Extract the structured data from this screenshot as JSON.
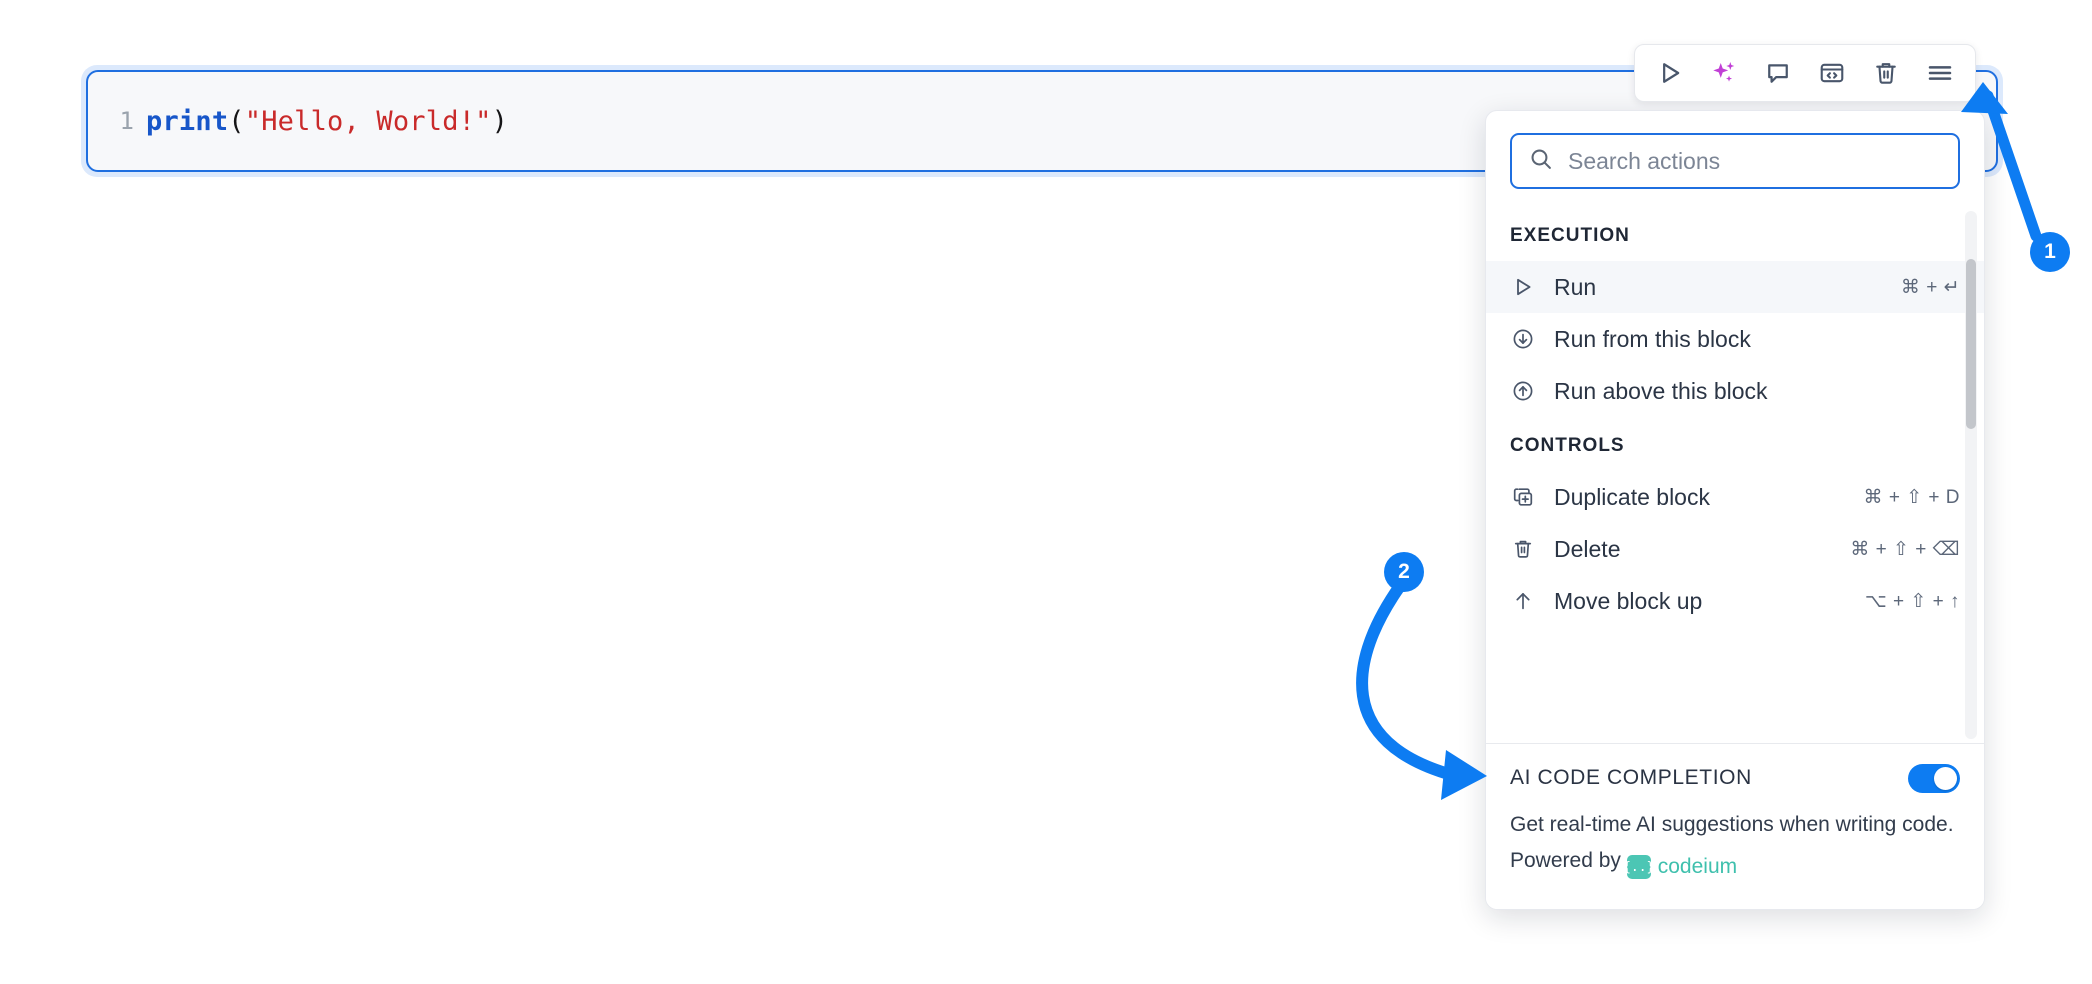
{
  "editor": {
    "line_number": "1",
    "code": {
      "fn": "print",
      "open": "(",
      "string": "\"Hello, World!\"",
      "close": ")"
    }
  },
  "toolbar": {
    "buttons": [
      {
        "name": "run-icon",
        "label": "Run"
      },
      {
        "name": "ai-sparkle-icon",
        "label": "AI"
      },
      {
        "name": "comment-icon",
        "label": "Comment"
      },
      {
        "name": "code-block-icon",
        "label": "Code"
      },
      {
        "name": "trash-icon",
        "label": "Delete"
      },
      {
        "name": "hamburger-menu-icon",
        "label": "Menu"
      }
    ]
  },
  "menu": {
    "search": {
      "placeholder": "Search actions",
      "value": ""
    },
    "sections": [
      {
        "header": "EXECUTION",
        "items": [
          {
            "label": "Run",
            "keys": "⌘ + ↵",
            "icon": "play-icon",
            "active": true
          },
          {
            "label": "Run from this block",
            "keys": "",
            "icon": "arrow-down-circle-icon",
            "active": false
          },
          {
            "label": "Run above this block",
            "keys": "",
            "icon": "arrow-up-circle-icon",
            "active": false
          }
        ]
      },
      {
        "header": "CONTROLS",
        "items": [
          {
            "label": "Duplicate block",
            "keys": "⌘ + ⇧ + D",
            "icon": "duplicate-icon",
            "active": false
          },
          {
            "label": "Delete",
            "keys": "⌘ + ⇧ + ⌫",
            "icon": "trash-icon",
            "active": false
          },
          {
            "label": "Move block up",
            "keys": "⌥ + ⇧ + ↑",
            "icon": "arrow-up-icon",
            "active": false
          }
        ]
      }
    ]
  },
  "ai_section": {
    "title": "AI CODE COMPLETION",
    "toggle_on": true,
    "description_prefix": "Get real-time AI suggestions when writing code. Powered by ",
    "brand_mark": "{..}",
    "brand_name": "codeium"
  },
  "annotations": [
    {
      "number": "1"
    },
    {
      "number": "2"
    }
  ],
  "colors": {
    "accent_blue": "#0d7cf2",
    "editor_border": "#1f6fe0",
    "ai_purple": "#c13fd6",
    "codeium_teal": "#3fc0ad",
    "code_string": "#c92a2a",
    "code_function": "#1756c9"
  }
}
